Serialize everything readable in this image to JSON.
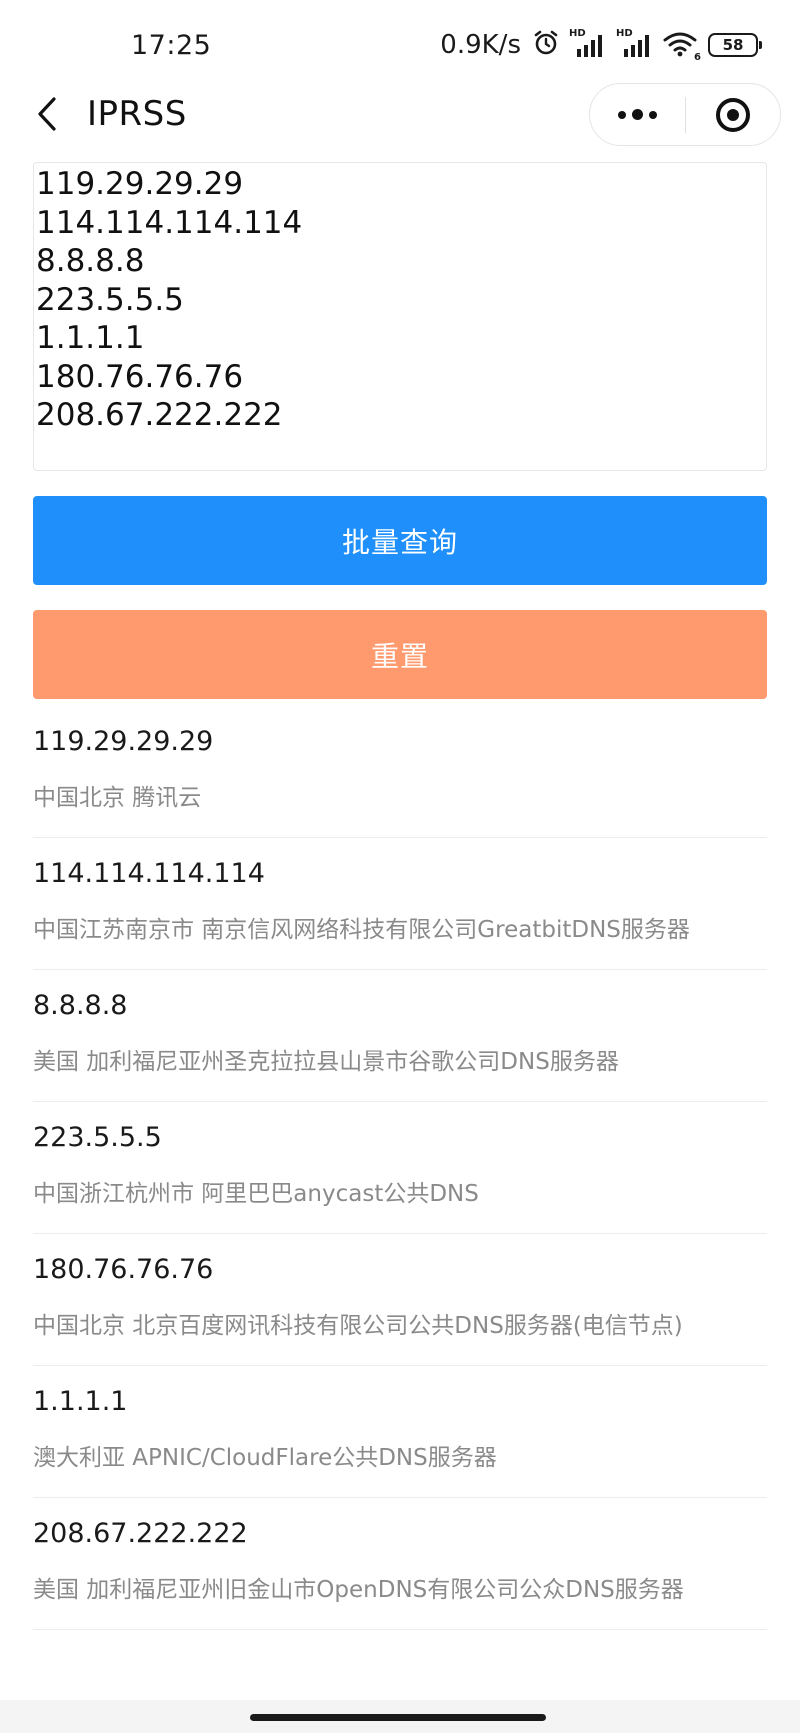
{
  "status_bar": {
    "time": "17:25",
    "net_speed": "0.9K/s",
    "signal1_label": "HD",
    "signal2_label": "HD",
    "wifi_label": "6",
    "battery": "58",
    "icons": [
      "alarm-icon",
      "signal-icon",
      "signal-icon",
      "wifi-icon",
      "battery-icon"
    ]
  },
  "nav": {
    "title": "IPRSS",
    "back_icon": "chevron-left-icon",
    "more_icon": "more-dots-icon",
    "close_icon": "target-circle-icon"
  },
  "input": {
    "lines": [
      "119.29.29.29",
      "114.114.114.114",
      "8.8.8.8",
      "223.5.5.5",
      "1.1.1.1",
      "180.76.76.76",
      "208.67.222.222"
    ]
  },
  "buttons": {
    "query_label": "批量查询",
    "reset_label": "重置"
  },
  "results": [
    {
      "ip": "119.29.29.29",
      "location": "中国北京 腾讯云"
    },
    {
      "ip": "114.114.114.114",
      "location": "中国江苏南京市 南京信风网络科技有限公司GreatbitDNS服务器"
    },
    {
      "ip": "8.8.8.8",
      "location": "美国 加利福尼亚州圣克拉拉县山景市谷歌公司DNS服务器"
    },
    {
      "ip": "223.5.5.5",
      "location": "中国浙江杭州市 阿里巴巴anycast公共DNS"
    },
    {
      "ip": "180.76.76.76",
      "location": "中国北京 北京百度网讯科技有限公司公共DNS服务器(电信节点)"
    },
    {
      "ip": "1.1.1.1",
      "location": "澳大利亚 APNIC/CloudFlare公共DNS服务器"
    },
    {
      "ip": "208.67.222.222",
      "location": "美国 加利福尼亚州旧金山市OpenDNS有限公司公众DNS服务器"
    }
  ],
  "colors": {
    "primary": "#1f90fb",
    "reset": "#fe9a6d",
    "secondary_text": "#8a8a8a"
  }
}
